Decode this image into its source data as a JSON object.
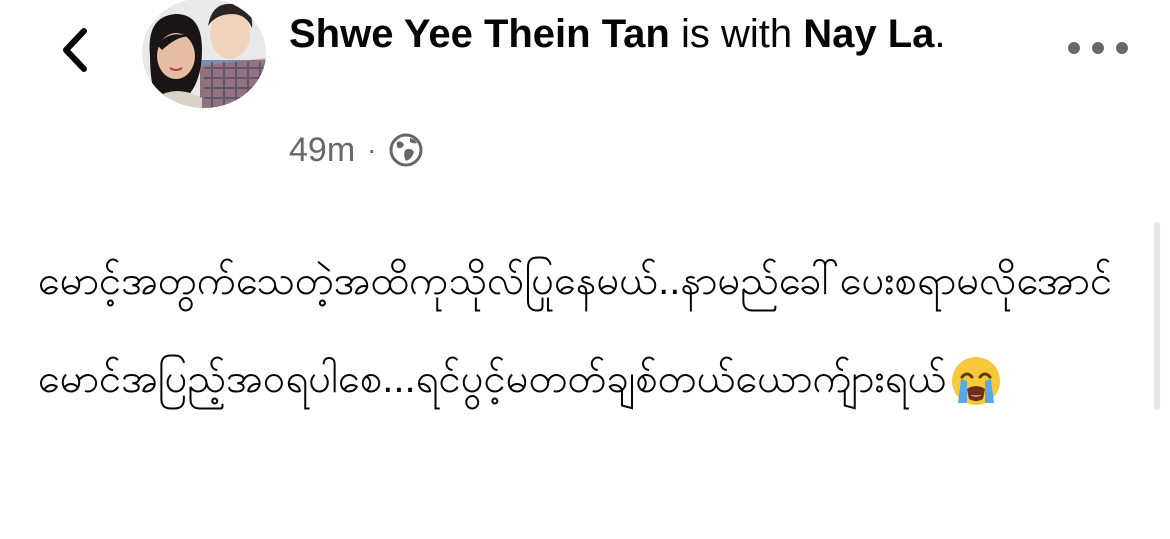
{
  "header": {
    "back_icon": "chevron-left-icon",
    "author_name": "Shwe Yee Thein Tan",
    "connector": " is with ",
    "tagged_name": "Nay La",
    "end_punctuation": ".",
    "timestamp": "49m",
    "separator": "·",
    "privacy_icon": "globe-icon",
    "more_icon": "more-horizontal-icon"
  },
  "post": {
    "text": "မောင့်အတွက်သေတဲ့အထိကုသိုလ်ပြုနေမယ်..နာမည်ခေါ်ပေးစရာမလိုအောင်မောင်အပြည့်အဝရပါစေ...ရင်ပွင့်မတတ်ချစ်တယ်ယောက်ျားရယ်",
    "emoji": "loudly-crying-face-emoji"
  },
  "colors": {
    "text_primary": "#050505",
    "text_secondary": "#65676b",
    "background": "#ffffff"
  }
}
